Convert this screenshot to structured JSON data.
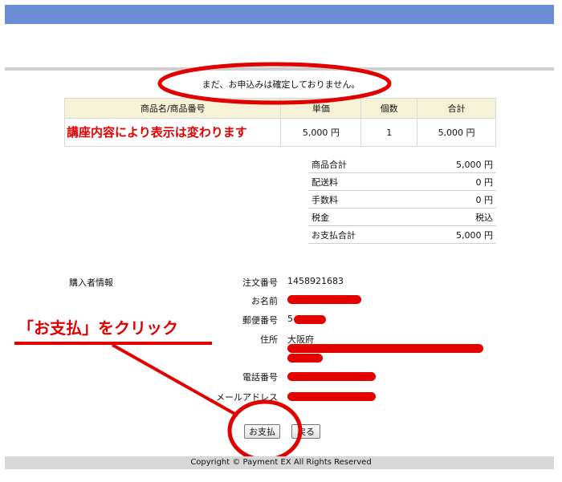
{
  "notice": "まだ、お申込みは確定しておりません。",
  "items_table": {
    "headers": [
      "商品名/商品番号",
      "単価",
      "個数",
      "合計"
    ],
    "row": {
      "name": "講座内容により表示は変わります",
      "unit_price": "5,000 円",
      "qty": "1",
      "total": "5,000 円"
    }
  },
  "totals": [
    {
      "label": "商品合計",
      "value": "5,000 円"
    },
    {
      "label": "配送料",
      "value": "0 円"
    },
    {
      "label": "手数料",
      "value": "0 円"
    },
    {
      "label": "税金",
      "value": "税込"
    },
    {
      "label": "お支払合計",
      "value": "5,000 円"
    }
  ],
  "buyer": {
    "section_label": "購入者情報",
    "order_no_label": "注文番号",
    "order_no": "1458921683",
    "name_label": "お名前",
    "zip_label": "郵便番号",
    "zip_prefix": "5",
    "address_label": "住所",
    "address_pref": "大阪府",
    "phone_label": "電話番号",
    "email_label": "メールアドレス"
  },
  "buttons": {
    "pay": "お支払",
    "back": "戻る"
  },
  "annotation": "「お支払」をクリック",
  "footer": "Copyright © Payment EX All Rights Reserved",
  "colors": {
    "top_bar": "#6b8dd6",
    "annotation_red": "#e00000",
    "header_bg": "#f6f2d8"
  }
}
